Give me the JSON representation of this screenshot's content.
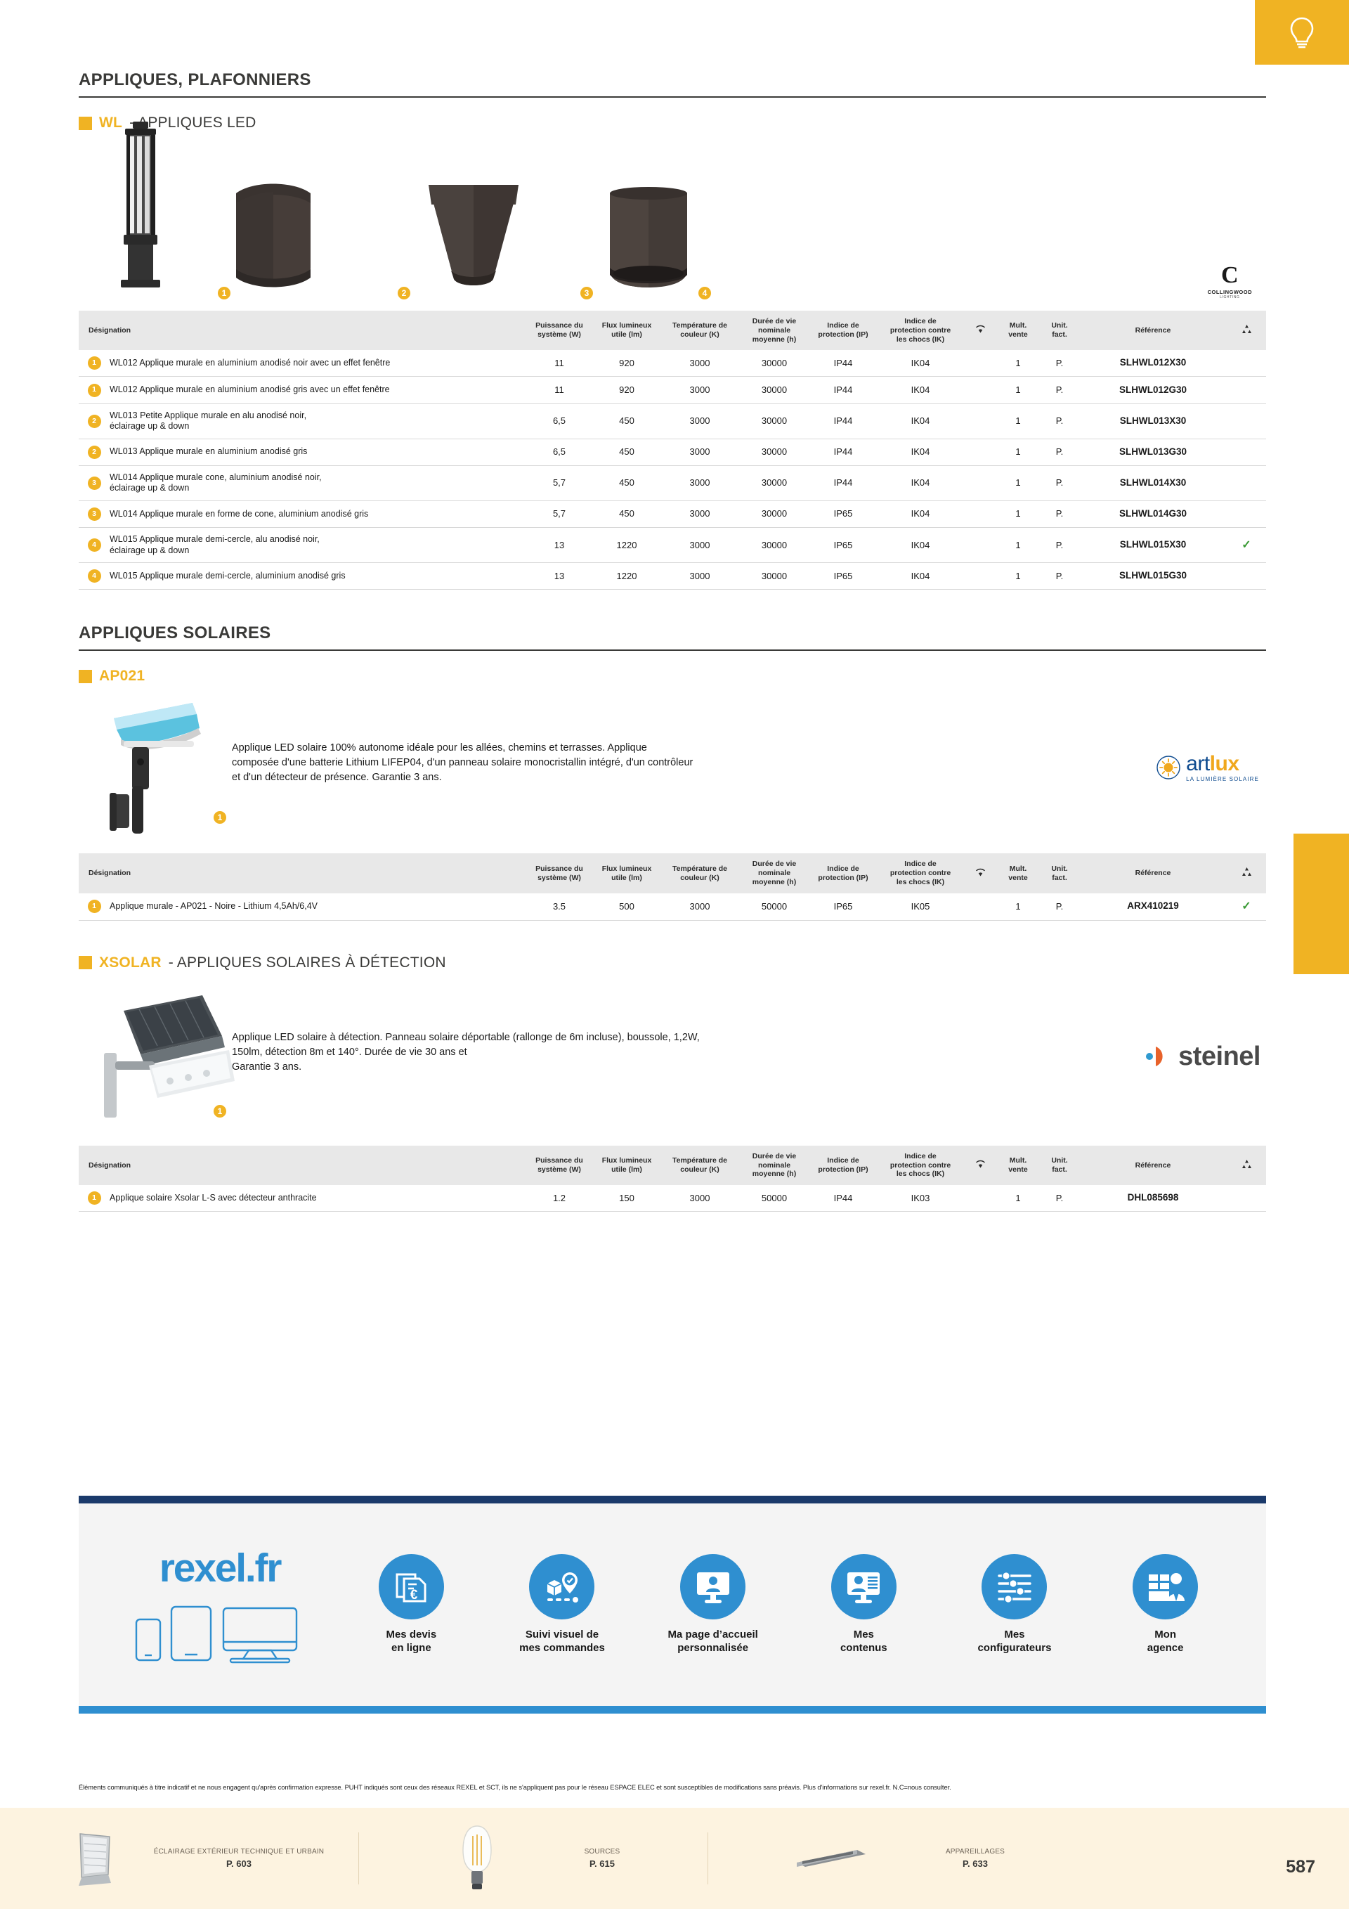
{
  "page": {
    "number": "587",
    "section_title": "APPLIQUES, PLAFONNIERS",
    "solar_section_title": "APPLIQUES SOLAIRES"
  },
  "wl_section": {
    "code": "WL",
    "rest": "- APPLIQUES LED",
    "brand": {
      "letter": "C",
      "name": "COLLINGWOOD",
      "tagline": "LIGHTING"
    },
    "photo_bullets": [
      "1",
      "2",
      "3",
      "4"
    ]
  },
  "table_headers": {
    "designation": "Désignation",
    "power": "Puissance du\nsystème (W)",
    "power_l1": "Puissance du",
    "power_l2": "système (W)",
    "flux_l1": "Flux lumineux",
    "flux_l2": "utile (lm)",
    "temp_l1": "Température de",
    "temp_l2": "couleur (K)",
    "life_l1": "Durée de vie",
    "life_l2": "nominale",
    "life_l3": "moyenne (h)",
    "ip_l1": "Indice de",
    "ip_l2": "protection (IP)",
    "ik_l1": "Indice de",
    "ik_l2": "protection contre",
    "ik_l3": "les chocs (IK)",
    "mult_l1": "Mult.",
    "mult_l2": "vente",
    "unit_l1": "Unit.",
    "unit_l2": "fact.",
    "reference": "Référence"
  },
  "wl_rows": [
    {
      "idx": "1",
      "desig": "WL012 Applique murale en aluminium anodisé noir avec un effet fenêtre",
      "power": "11",
      "flux": "920",
      "temp": "3000",
      "life": "30000",
      "ip": "IP44",
      "ik": "IK04",
      "mult": "1",
      "unit": "P.",
      "ref": "SLHWL012X30",
      "check": false
    },
    {
      "idx": "1",
      "desig": "WL012 Applique murale en aluminium anodisé gris avec un effet fenêtre",
      "power": "11",
      "flux": "920",
      "temp": "3000",
      "life": "30000",
      "ip": "IP44",
      "ik": "IK04",
      "mult": "1",
      "unit": "P.",
      "ref": "SLHWL012G30",
      "check": false
    },
    {
      "idx": "2",
      "desig": "WL013 Petite Applique murale en alu anodisé noir,\néclairage up & down",
      "power": "6,5",
      "flux": "450",
      "temp": "3000",
      "life": "30000",
      "ip": "IP44",
      "ik": "IK04",
      "mult": "1",
      "unit": "P.",
      "ref": "SLHWL013X30",
      "check": false
    },
    {
      "idx": "2",
      "desig": "WL013 Applique murale en aluminium anodisé gris",
      "power": "6,5",
      "flux": "450",
      "temp": "3000",
      "life": "30000",
      "ip": "IP44",
      "ik": "IK04",
      "mult": "1",
      "unit": "P.",
      "ref": "SLHWL013G30",
      "check": false
    },
    {
      "idx": "3",
      "desig": "WL014 Applique murale cone, aluminium anodisé noir,\néclairage up & down",
      "power": "5,7",
      "flux": "450",
      "temp": "3000",
      "life": "30000",
      "ip": "IP44",
      "ik": "IK04",
      "mult": "1",
      "unit": "P.",
      "ref": "SLHWL014X30",
      "check": false
    },
    {
      "idx": "3",
      "desig": "WL014 Applique murale en forme de cone, aluminium anodisé gris",
      "power": "5,7",
      "flux": "450",
      "temp": "3000",
      "life": "30000",
      "ip": "IP65",
      "ik": "IK04",
      "mult": "1",
      "unit": "P.",
      "ref": "SLHWL014G30",
      "check": false
    },
    {
      "idx": "4",
      "desig": "WL015 Applique murale demi-cercle, alu anodisé noir,\néclairage up & down",
      "power": "13",
      "flux": "1220",
      "temp": "3000",
      "life": "30000",
      "ip": "IP65",
      "ik": "IK04",
      "mult": "1",
      "unit": "P.",
      "ref": "SLHWL015X30",
      "check": true
    },
    {
      "idx": "4",
      "desig": "WL015 Applique murale demi-cercle, aluminium anodisé gris",
      "power": "13",
      "flux": "1220",
      "temp": "3000",
      "life": "30000",
      "ip": "IP65",
      "ik": "IK04",
      "mult": "1",
      "unit": "P.",
      "ref": "SLHWL015G30",
      "check": false
    }
  ],
  "ap021_section": {
    "code": "AP021",
    "rest": "",
    "bullet": "1",
    "description": "Applique LED solaire 100% autonome idéale pour les allées, chemins et terrasses. Applique composée d'une batterie Lithium LIFEP04, d'un panneau solaire monocristallin intégré, d'un contrôleur et d'un détecteur de présence. Garantie 3 ans.",
    "brand": {
      "name_light": "art",
      "name_bold": "lux",
      "tagline": "LA LUMIÈRE SOLAIRE"
    },
    "rows": [
      {
        "idx": "1",
        "desig": "Applique murale - AP021 - Noire - Lithium 4,5Ah/6,4V",
        "power": "3.5",
        "flux": "500",
        "temp": "3000",
        "life": "50000",
        "ip": "IP65",
        "ik": "IK05",
        "mult": "1",
        "unit": "P.",
        "ref": "ARX410219",
        "check": true
      }
    ]
  },
  "xsolar_section": {
    "code": "XSOLAR",
    "rest": "- APPLIQUES SOLAIRES À DÉTECTION",
    "bullet": "1",
    "description": "Applique LED solaire à détection. Panneau solaire déportable (rallonge de 6m incluse), boussole, 1,2W, 150lm, détection 8m et 140°. Durée de vie 30 ans et\nGarantie 3 ans.",
    "brand": {
      "name": "steinel"
    },
    "rows": [
      {
        "idx": "1",
        "desig": "Applique solaire Xsolar L-S avec détecteur anthracite",
        "power": "1.2",
        "flux": "150",
        "temp": "3000",
        "life": "50000",
        "ip": "IP44",
        "ik": "IK03",
        "mult": "1",
        "unit": "P.",
        "ref": "DHL085698",
        "check": false
      }
    ]
  },
  "banner": {
    "logo": "rexel.fr",
    "services": [
      {
        "icon": "quote-euro-icon",
        "label": "Mes devis\nen ligne",
        "l1": "Mes devis",
        "l2": "en ligne"
      },
      {
        "icon": "package-tracking-icon",
        "label": "Suivi visuel de\nmes commandes",
        "l1": "Suivi visuel de",
        "l2": "mes commandes"
      },
      {
        "icon": "personalized-homepage-icon",
        "label": "Ma page d'accueil\npersonnalisée",
        "l1": "Ma page d’accueil",
        "l2": "personnalisée"
      },
      {
        "icon": "my-contents-icon",
        "label": "Mes\ncontenus",
        "l1": "Mes",
        "l2": "contenus"
      },
      {
        "icon": "configurator-sliders-icon",
        "label": "Mes\nconfigurateurs",
        "l1": "Mes",
        "l2": "configurateurs"
      },
      {
        "icon": "agency-person-icon",
        "label": "Mon\nagence",
        "l1": "Mon",
        "l2": "agence"
      }
    ]
  },
  "disclaimer": "Éléments communiqués à titre indicatif et ne nous engagent qu'après confirmation expresse. PUHT indiqués sont ceux des réseaux REXEL et SCT, ils ne s'appliquent pas pour le réseau ESPACE ELEC et sont susceptibles de modifications sans préavis. Plus d'informations sur rexel.fr. N.C=nous consulter.",
  "bottom_nav": [
    {
      "title": "ÉCLAIRAGE EXTÉRIEUR TECHNIQUE ET URBAIN",
      "page": "P. 603",
      "icon": "floodlight-icon"
    },
    {
      "title": "SOURCES",
      "page": "P. 615",
      "icon": "bulb-icon"
    },
    {
      "title": "APPAREILLAGES",
      "page": "P. 633",
      "icon": "driver-icon"
    }
  ],
  "colors": {
    "accent_yellow": "#f0b323",
    "rexel_blue": "#2f8fd0",
    "navy": "#1b3a6b",
    "check_green": "#3a9a35"
  }
}
